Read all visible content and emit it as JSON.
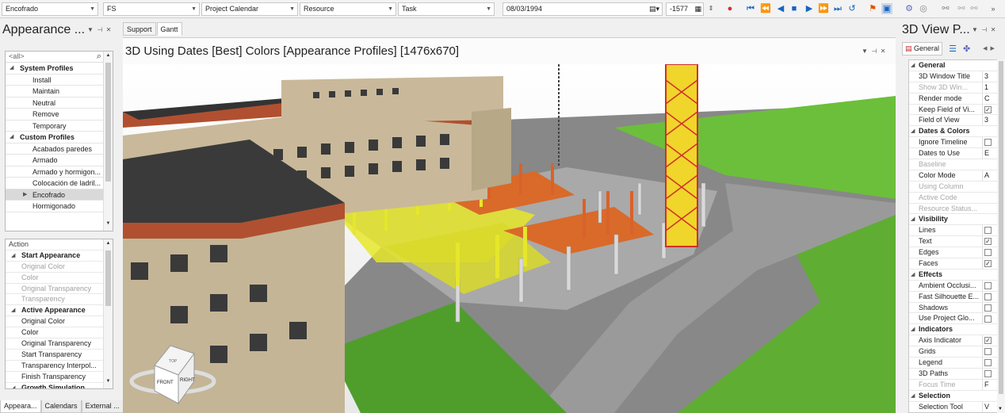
{
  "toolbar": {
    "combo1": "Encofrado",
    "combo2": "FS",
    "combo3": "Project Calendar",
    "combo4": "Resource",
    "combo5": "Task",
    "date": "08/03/1994",
    "offset": "-1577"
  },
  "left": {
    "title": "Appearance ...",
    "search_placeholder": "<all>",
    "items": [
      {
        "type": "group",
        "label": "System Profiles"
      },
      {
        "type": "item",
        "label": "Install"
      },
      {
        "type": "item",
        "label": "Maintain"
      },
      {
        "type": "item",
        "label": "Neutral"
      },
      {
        "type": "item",
        "label": "Remove"
      },
      {
        "type": "item",
        "label": "Temporary"
      },
      {
        "type": "group",
        "label": "Custom Profiles"
      },
      {
        "type": "item",
        "label": "Acabados paredes"
      },
      {
        "type": "item",
        "label": "Armado"
      },
      {
        "type": "item",
        "label": "Armado y hormigon..."
      },
      {
        "type": "item",
        "label": "Colocación de ladril..."
      },
      {
        "type": "item",
        "label": "Encofrado"
      },
      {
        "type": "item",
        "label": "Hormigonado"
      }
    ],
    "props_header": "Action",
    "props": [
      {
        "type": "group",
        "label": "Start Appearance"
      },
      {
        "type": "dis",
        "label": "Original Color"
      },
      {
        "type": "dis",
        "label": "Color"
      },
      {
        "type": "dis",
        "label": "Original Transparency"
      },
      {
        "type": "dis",
        "label": "Transparency"
      },
      {
        "type": "group",
        "label": "Active Appearance"
      },
      {
        "type": "item",
        "label": "Original Color"
      },
      {
        "type": "item",
        "label": "Color"
      },
      {
        "type": "item",
        "label": "Original Transparency"
      },
      {
        "type": "item",
        "label": "Start Transparency"
      },
      {
        "type": "item",
        "label": "Transparency Interpol..."
      },
      {
        "type": "item",
        "label": "Finish Transparency"
      },
      {
        "type": "group",
        "label": "Growth Simulation"
      }
    ],
    "tabs": [
      "Appeara...",
      "Calendars",
      "External ..."
    ]
  },
  "center": {
    "tabs": [
      "Support",
      "Gantt"
    ],
    "view_title": "3D Using Dates [Best] Colors [Appearance Profiles]  [1476x670]",
    "cube_front": "FRONT",
    "cube_right": "RIGHT",
    "cube_top": "TOP"
  },
  "right": {
    "title": "3D View P...",
    "tab_general": "General",
    "rows": [
      {
        "type": "group",
        "label": "General"
      },
      {
        "type": "prop",
        "label": "3D Window Title",
        "value": "3"
      },
      {
        "type": "dis",
        "label": "Show 3D Win...",
        "value": "1"
      },
      {
        "type": "prop",
        "label": "Render mode",
        "value": "C"
      },
      {
        "type": "check",
        "label": "Keep Field of Vi...",
        "checked": true
      },
      {
        "type": "prop",
        "label": "Field of View",
        "value": "3"
      },
      {
        "type": "group",
        "label": "Dates & Colors"
      },
      {
        "type": "check",
        "label": "Ignore Timeline",
        "checked": false
      },
      {
        "type": "prop",
        "label": "Dates to Use",
        "value": "E"
      },
      {
        "type": "dis",
        "label": "Baseline",
        "value": ""
      },
      {
        "type": "prop",
        "label": "Color Mode",
        "value": "A"
      },
      {
        "type": "dis",
        "label": "Using Column",
        "value": ""
      },
      {
        "type": "dis",
        "label": "Active Code",
        "value": ""
      },
      {
        "type": "dis",
        "label": "Resource Status...",
        "value": ""
      },
      {
        "type": "group",
        "label": "Visibility"
      },
      {
        "type": "check",
        "label": "Lines",
        "checked": false
      },
      {
        "type": "check",
        "label": "Text",
        "checked": true
      },
      {
        "type": "check",
        "label": "Edges",
        "checked": false
      },
      {
        "type": "check",
        "label": "Faces",
        "checked": true
      },
      {
        "type": "group",
        "label": "Effects"
      },
      {
        "type": "check",
        "label": "Ambient Occlusi...",
        "checked": false
      },
      {
        "type": "check",
        "label": "Fast Silhouette E...",
        "checked": false
      },
      {
        "type": "check",
        "label": "Shadows",
        "checked": false
      },
      {
        "type": "check",
        "label": "Use Project Glo...",
        "checked": false
      },
      {
        "type": "group",
        "label": "Indicators"
      },
      {
        "type": "check",
        "label": "Axis Indicator",
        "checked": true
      },
      {
        "type": "check",
        "label": "Grids",
        "checked": false
      },
      {
        "type": "check",
        "label": "Legend",
        "checked": false
      },
      {
        "type": "check",
        "label": "3D Paths",
        "checked": false
      },
      {
        "type": "dis",
        "label": "Focus Time",
        "value": "F"
      },
      {
        "type": "group",
        "label": "Selection"
      },
      {
        "type": "prop",
        "label": "Selection Tool",
        "value": "V"
      }
    ]
  }
}
